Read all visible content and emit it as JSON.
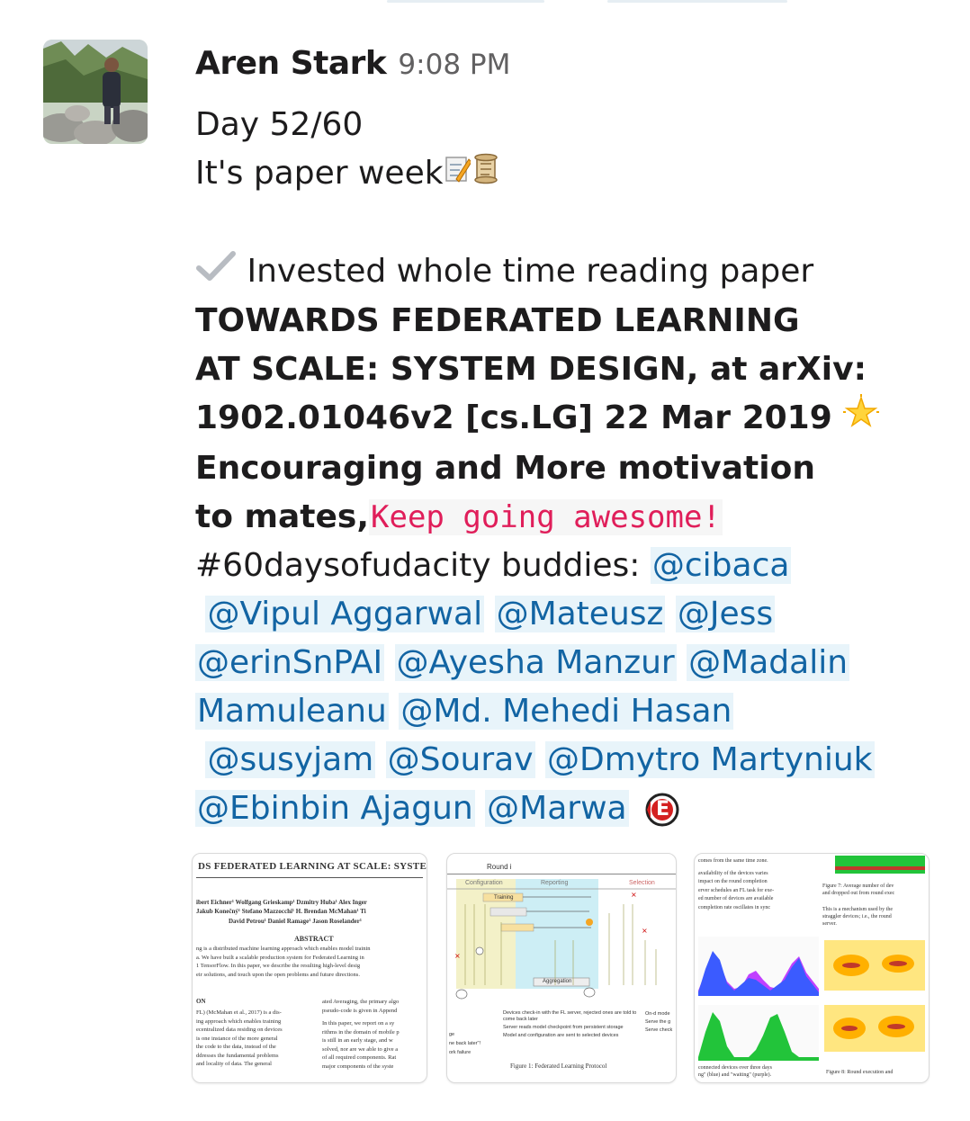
{
  "message": {
    "author": "Aren Stark",
    "time": "9:08 PM",
    "line1": "Day 52/60",
    "line2": "It's paper week",
    "line4": "Invested whole time reading paper",
    "bold_lines": [
      "TOWARDS FEDERATED LEARNING",
      "AT SCALE: SYSTEM DESIGN, at arXiv:",
      "1902.01046v2 [cs.LG] 22 Mar 2019",
      "Encouraging and More motivation",
      "to mates,"
    ],
    "code_text": "Keep going awesome!",
    "hashtag_text": "#60daysofudacity buddies: ",
    "mentions": [
      "@cibaca",
      "@Vipul Aggarwal",
      "@Mateusz",
      "@Jess",
      "@erinSnPAI",
      "@Ayesha Manzur",
      "@Madalin",
      "Mamuleanu",
      "@Md. Mehedi Hasan",
      "@susyjam",
      "@Sourav",
      "@Dmytro Martyniuk",
      "@Ebinbin Ajagun",
      "@Marwa"
    ],
    "custom_emoji": "E"
  },
  "icons": {
    "memo": "memo-icon",
    "scroll": "scroll-icon",
    "check": "check-mark-icon",
    "star": "glowing-star-icon"
  },
  "attachments": {
    "paper1": {
      "title": "DS FEDERATED LEARNING AT SCALE: SYSTE",
      "authors1": "ibert Eichner¹ Wolfgang Grieskamp¹ Dzmitry Huba¹ Alex Inger",
      "authors2": "Jakub Konečný¹ Stefano Mazzocchi¹ H. Brendan McMahan¹ Ti",
      "authors3": "David Petrou¹ Daniel Ramage¹ Jason Roselander¹",
      "abstract_head": "ABSTRACT",
      "abstract": [
        "ng is a distributed machine learning approach which enables model trainin",
        "a. We have built a scalable production system for Federated Learning in",
        "1 TensorFlow. In this paper, we describe the resulting high-level desig",
        "eir solutions, and touch upon the open problems and future directions."
      ],
      "section": "ON",
      "col_left": [
        "FL) (McMahan et al., 2017) is a dis-",
        "ing approach which enables training",
        "ecentralized data residing on devices",
        "is one instance of the more general",
        "the code to the data, instead of the",
        "ddresses the fundamental problems",
        "and locality of data. The general"
      ],
      "col_right": [
        "ated Averaging, the primary algo",
        "pseudo-code is given in Append",
        "In this paper, we report on a sy",
        "rithms in the domain of mobile p",
        "is still in an early stage, and w",
        "solved, nor are we able to give a",
        "of all required components. Rat",
        "major components of the syste"
      ]
    },
    "paper2": {
      "round": "Round i",
      "phase1": "Configuration",
      "phase2": "Reporting",
      "phase3": "Selection",
      "training": "Training",
      "aggregation": "Aggregation",
      "legend": [
        "Devices check-in with the FL server, rejected ones are told to come back later",
        "Server reads model checkpoint from persistent storage",
        "Model and configuration are sent to selected devices"
      ],
      "legend_right": [
        "On-d mode",
        "Serve the g",
        "Serve check"
      ],
      "left_notes": [
        "ge",
        "ne back later\"!",
        "ork failure"
      ],
      "caption": "Figure 1: Federated Learning Protocol"
    },
    "paper3": {
      "text_top": [
        "comes from the same time zone.",
        "availability of the devices varies",
        "impact on the round completion",
        "erver schedules an FL task for exe-",
        "ed number of devices are available",
        "completion rate oscillates in sync"
      ],
      "fig7": [
        "Figure 7: Average number of dev",
        "and dropped out from round exec"
      ],
      "right_text": [
        "This is a mechanism used by the",
        "straggler devices; i.e., the round",
        "server."
      ],
      "bottom_text": [
        "connected devices over three days",
        "ng\" (blue) and \"waiting\" (purple)."
      ],
      "fig8": "Figure 8: Round execution and",
      "colors": {
        "blue": "#3b5bff",
        "purple": "#c040ff",
        "green": "#22c43a",
        "heat": "#ffd24a"
      }
    }
  }
}
